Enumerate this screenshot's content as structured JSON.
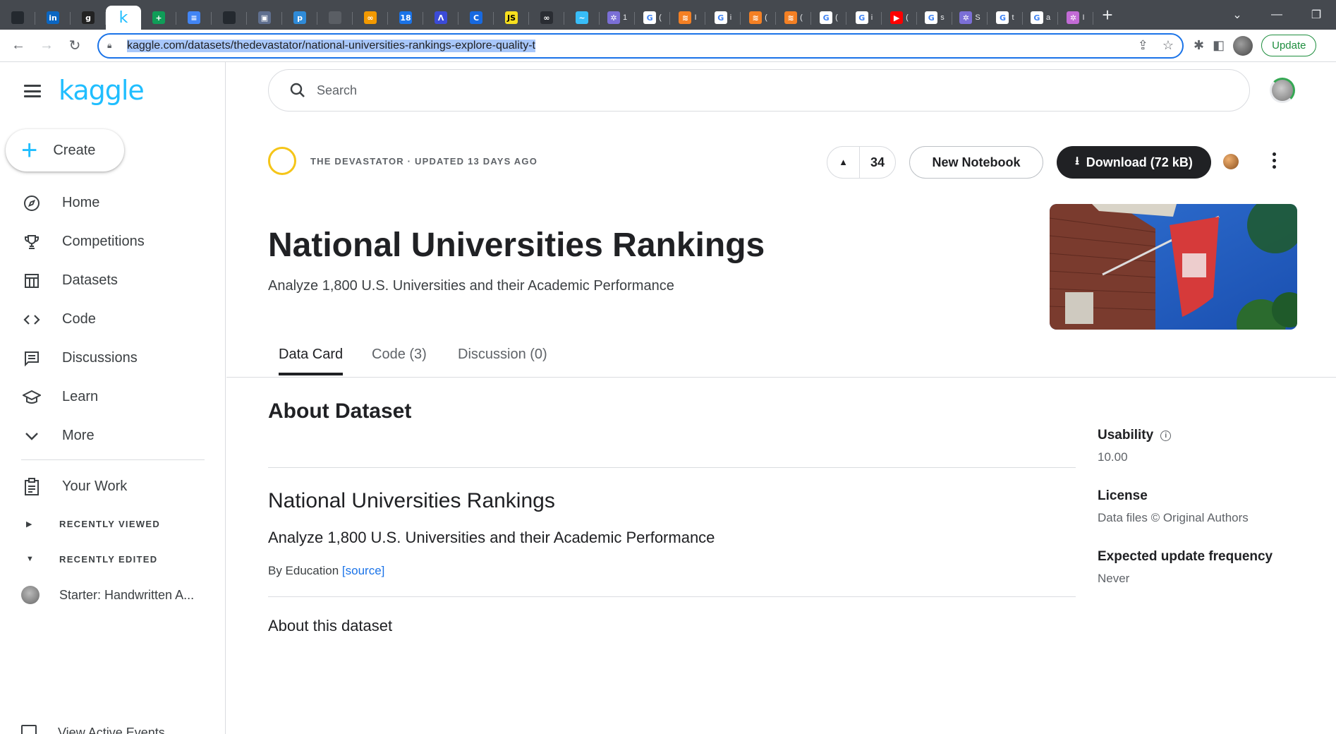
{
  "browser": {
    "tabs": [
      {
        "icon": "github-icon",
        "glyph": "",
        "bg": "#24292f",
        "title": ""
      },
      {
        "icon": "linkedin-icon",
        "glyph": "in",
        "bg": "#0a66c2",
        "title": ""
      },
      {
        "icon": "g-icon",
        "glyph": "g",
        "bg": "#222",
        "title": ""
      },
      {
        "icon": "kaggle-icon",
        "glyph": "k",
        "bg": "#fff",
        "title": "",
        "active": true
      },
      {
        "icon": "plus-green-icon",
        "glyph": "+",
        "bg": "#0f9d58",
        "title": ""
      },
      {
        "icon": "docs-icon",
        "glyph": "≡",
        "bg": "#4285f4",
        "title": ""
      },
      {
        "icon": "github-icon",
        "glyph": "",
        "bg": "#24292f",
        "title": ""
      },
      {
        "icon": "app-icon",
        "glyph": "▣",
        "bg": "#5f6f8f",
        "title": ""
      },
      {
        "icon": "pycharm-icon",
        "glyph": "p",
        "bg": "#2f8bd8",
        "title": ""
      },
      {
        "icon": "blank-icon",
        "glyph": "",
        "bg": "#5a5e64",
        "title": ""
      },
      {
        "icon": "infinity-icon",
        "glyph": "∞",
        "bg": "#f29900",
        "title": ""
      },
      {
        "icon": "calendar-icon",
        "glyph": "18",
        "bg": "#1a73e8",
        "title": ""
      },
      {
        "icon": "a-icon",
        "glyph": "Λ",
        "bg": "#3b4bd8",
        "title": ""
      },
      {
        "icon": "c-icon",
        "glyph": "C",
        "bg": "#1769e0",
        "title": ""
      },
      {
        "icon": "js-icon",
        "glyph": "JS",
        "bg": "#f7df1e",
        "title": ""
      },
      {
        "icon": "link-icon",
        "glyph": "∞",
        "bg": "#2a2d33",
        "title": ""
      },
      {
        "icon": "wave-icon",
        "glyph": "~",
        "bg": "#38bdf8",
        "title": ""
      },
      {
        "icon": "sparkle-icon",
        "glyph": "✲",
        "bg": "#7b6fd6",
        "title": "1"
      },
      {
        "icon": "google-icon",
        "glyph": "G",
        "bg": "#fff",
        "title": "("
      },
      {
        "icon": "stack-icon",
        "glyph": "≋",
        "bg": "#f48024",
        "title": "I"
      },
      {
        "icon": "google-icon",
        "glyph": "G",
        "bg": "#fff",
        "title": "i"
      },
      {
        "icon": "stack-icon",
        "glyph": "≋",
        "bg": "#f48024",
        "title": "("
      },
      {
        "icon": "stack-icon",
        "glyph": "≋",
        "bg": "#f48024",
        "title": "("
      },
      {
        "icon": "google-icon",
        "glyph": "G",
        "bg": "#fff",
        "title": "("
      },
      {
        "icon": "google-icon",
        "glyph": "G",
        "bg": "#fff",
        "title": "i"
      },
      {
        "icon": "youtube-icon",
        "glyph": "▶",
        "bg": "#ff0000",
        "title": "("
      },
      {
        "icon": "google-icon",
        "glyph": "G",
        "bg": "#fff",
        "title": "s"
      },
      {
        "icon": "sparkle-icon",
        "glyph": "✲",
        "bg": "#7b6fd6",
        "title": "S"
      },
      {
        "icon": "google-icon",
        "glyph": "G",
        "bg": "#fff",
        "title": "t"
      },
      {
        "icon": "google-icon",
        "glyph": "G",
        "bg": "#fff",
        "title": "a"
      },
      {
        "icon": "sparkle-icon",
        "glyph": "✲",
        "bg": "#c26bd6",
        "title": "I"
      }
    ],
    "url": "kaggle.com/datasets/thedevastator/national-universities-rankings-explore-quality-t",
    "update_label": "Update"
  },
  "sidebar": {
    "logo": "kaggle",
    "create_label": "Create",
    "items": [
      {
        "label": "Home",
        "icon": "compass-icon"
      },
      {
        "label": "Competitions",
        "icon": "trophy-icon"
      },
      {
        "label": "Datasets",
        "icon": "table-icon"
      },
      {
        "label": "Code",
        "icon": "code-icon"
      },
      {
        "label": "Discussions",
        "icon": "discussion-icon"
      },
      {
        "label": "Learn",
        "icon": "graduation-cap-icon"
      },
      {
        "label": "More",
        "icon": "chevron-down-icon"
      }
    ],
    "your_work": "Your Work",
    "recently_viewed": "RECENTLY VIEWED",
    "recently_edited": "RECENTLY EDITED",
    "recent_item": "Starter: Handwritten A...",
    "cut_item": "View Active Events"
  },
  "header": {
    "search_placeholder": "Search"
  },
  "dataset": {
    "owner_line": "THE DEVASTATOR · UPDATED 13 DAYS AGO",
    "upvotes": "34",
    "new_notebook_label": "New Notebook",
    "download_label": "Download (72 kB)",
    "title": "National Universities Rankings",
    "subtitle": "Analyze 1,800 U.S. Universities and their Academic Performance",
    "tabs": [
      "Data Card",
      "Code (3)",
      "Discussion (0)"
    ],
    "active_tab": 0
  },
  "content": {
    "about_heading": "About Dataset",
    "section_title": "National Universities Rankings",
    "section_desc": "Analyze 1,800 U.S. Universities and their Academic Performance",
    "by_prefix": "By Education ",
    "source_link": "[source]",
    "about_this": "About this dataset"
  },
  "meta": {
    "usability_label": "Usability",
    "usability_value": "10.00",
    "license_label": "License",
    "license_value": "Data files © Original Authors",
    "frequency_label": "Expected update frequency",
    "frequency_value": "Never"
  },
  "colors": {
    "kaggle_blue": "#20beff",
    "download_bg": "#202124",
    "owner_ring": "#f5c518",
    "link": "#1a73e8"
  }
}
